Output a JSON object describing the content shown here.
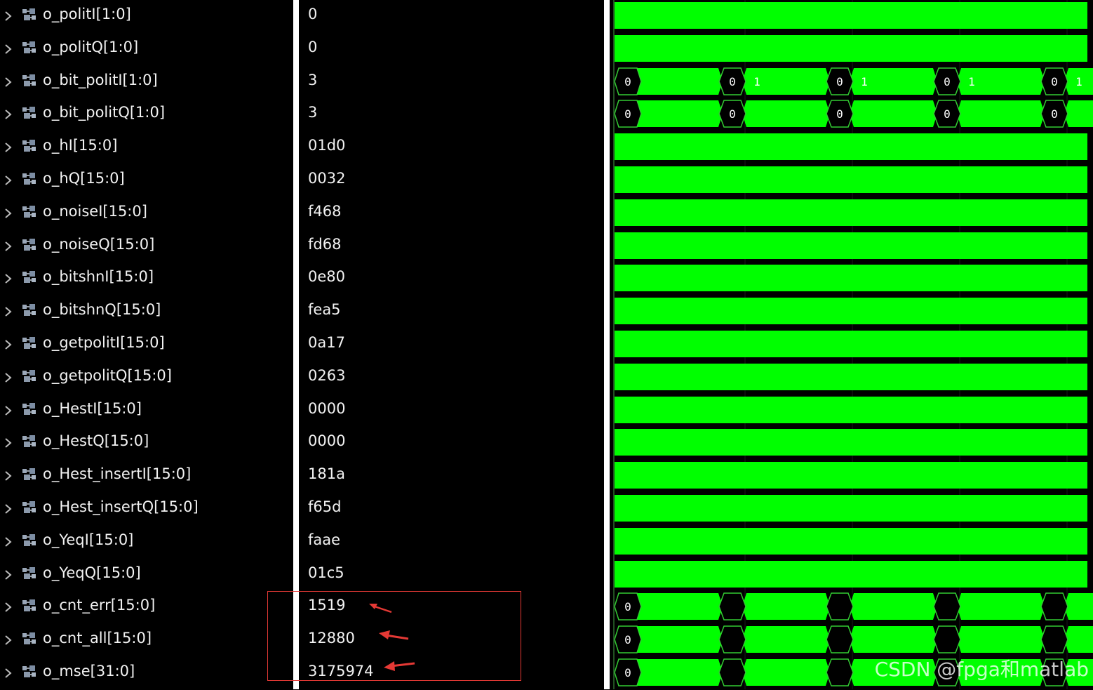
{
  "signals": [
    {
      "name": "o_politI[1:0]",
      "value": "0",
      "wave": "solid"
    },
    {
      "name": "o_politQ[1:0]",
      "value": "0",
      "wave": "solid"
    },
    {
      "name": "o_bit_politI[1:0]",
      "value": "3",
      "wave": "bus",
      "segments": [
        {
          "label": "0"
        },
        {
          "label": "1"
        },
        {
          "label": "1"
        },
        {
          "label": "1"
        },
        {
          "label": "1"
        }
      ],
      "transition_labels": [
        "0",
        "0",
        "0",
        "0"
      ]
    },
    {
      "name": "o_bit_politQ[1:0]",
      "value": "3",
      "wave": "bus",
      "segments": [
        {
          "label": "0"
        },
        {
          "label": ""
        },
        {
          "label": ""
        },
        {
          "label": ""
        },
        {
          "label": ""
        }
      ],
      "transition_labels": [
        "0",
        "0",
        "0",
        "0"
      ]
    },
    {
      "name": "o_hI[15:0]",
      "value": "01d0",
      "wave": "solid"
    },
    {
      "name": "o_hQ[15:0]",
      "value": "0032",
      "wave": "solid"
    },
    {
      "name": "o_noiseI[15:0]",
      "value": "f468",
      "wave": "solid"
    },
    {
      "name": "o_noiseQ[15:0]",
      "value": "fd68",
      "wave": "solid"
    },
    {
      "name": "o_bitshnI[15:0]",
      "value": "0e80",
      "wave": "solid"
    },
    {
      "name": "o_bitshnQ[15:0]",
      "value": "fea5",
      "wave": "solid"
    },
    {
      "name": "o_getpolitI[15:0]",
      "value": "0a17",
      "wave": "solid"
    },
    {
      "name": "o_getpolitQ[15:0]",
      "value": "0263",
      "wave": "solid"
    },
    {
      "name": "o_HestI[15:0]",
      "value": "0000",
      "wave": "solid"
    },
    {
      "name": "o_HestQ[15:0]",
      "value": "0000",
      "wave": "solid"
    },
    {
      "name": "o_Hest_insertI[15:0]",
      "value": "181a",
      "wave": "solid"
    },
    {
      "name": "o_Hest_insertQ[15:0]",
      "value": "f65d",
      "wave": "solid"
    },
    {
      "name": "o_YeqI[15:0]",
      "value": "faae",
      "wave": "solid"
    },
    {
      "name": "o_YeqQ[15:0]",
      "value": "01c5",
      "wave": "solid"
    },
    {
      "name": "o_cnt_err[15:0]",
      "value": "1519",
      "wave": "bus",
      "segments": [
        {
          "label": "0"
        },
        {
          "label": ""
        },
        {
          "label": ""
        },
        {
          "label": ""
        },
        {
          "label": ""
        }
      ],
      "transition_labels": [
        "",
        "",
        "",
        ""
      ]
    },
    {
      "name": "o_cnt_all[15:0]",
      "value": "12880",
      "wave": "bus",
      "segments": [
        {
          "label": "0"
        },
        {
          "label": ""
        },
        {
          "label": ""
        },
        {
          "label": ""
        },
        {
          "label": ""
        }
      ],
      "transition_labels": [
        "",
        "",
        "",
        ""
      ]
    },
    {
      "name": "o_mse[31:0]",
      "value": "3175974",
      "wave": "bus",
      "segments": [
        {
          "label": "0"
        },
        {
          "label": ""
        },
        {
          "label": ""
        },
        {
          "label": ""
        },
        {
          "label": ""
        }
      ],
      "transition_labels": [
        "",
        "",
        "",
        ""
      ]
    }
  ],
  "icons": {
    "expand": "chevron-right-icon",
    "signal": "bus-signal-icon"
  },
  "colors": {
    "wave": "#00ff00",
    "wave_edge": "#33cc33",
    "background": "#000000",
    "highlight": "#e53935",
    "text": "#f2f2f2"
  },
  "watermark": "CSDN @fpga和matlab"
}
